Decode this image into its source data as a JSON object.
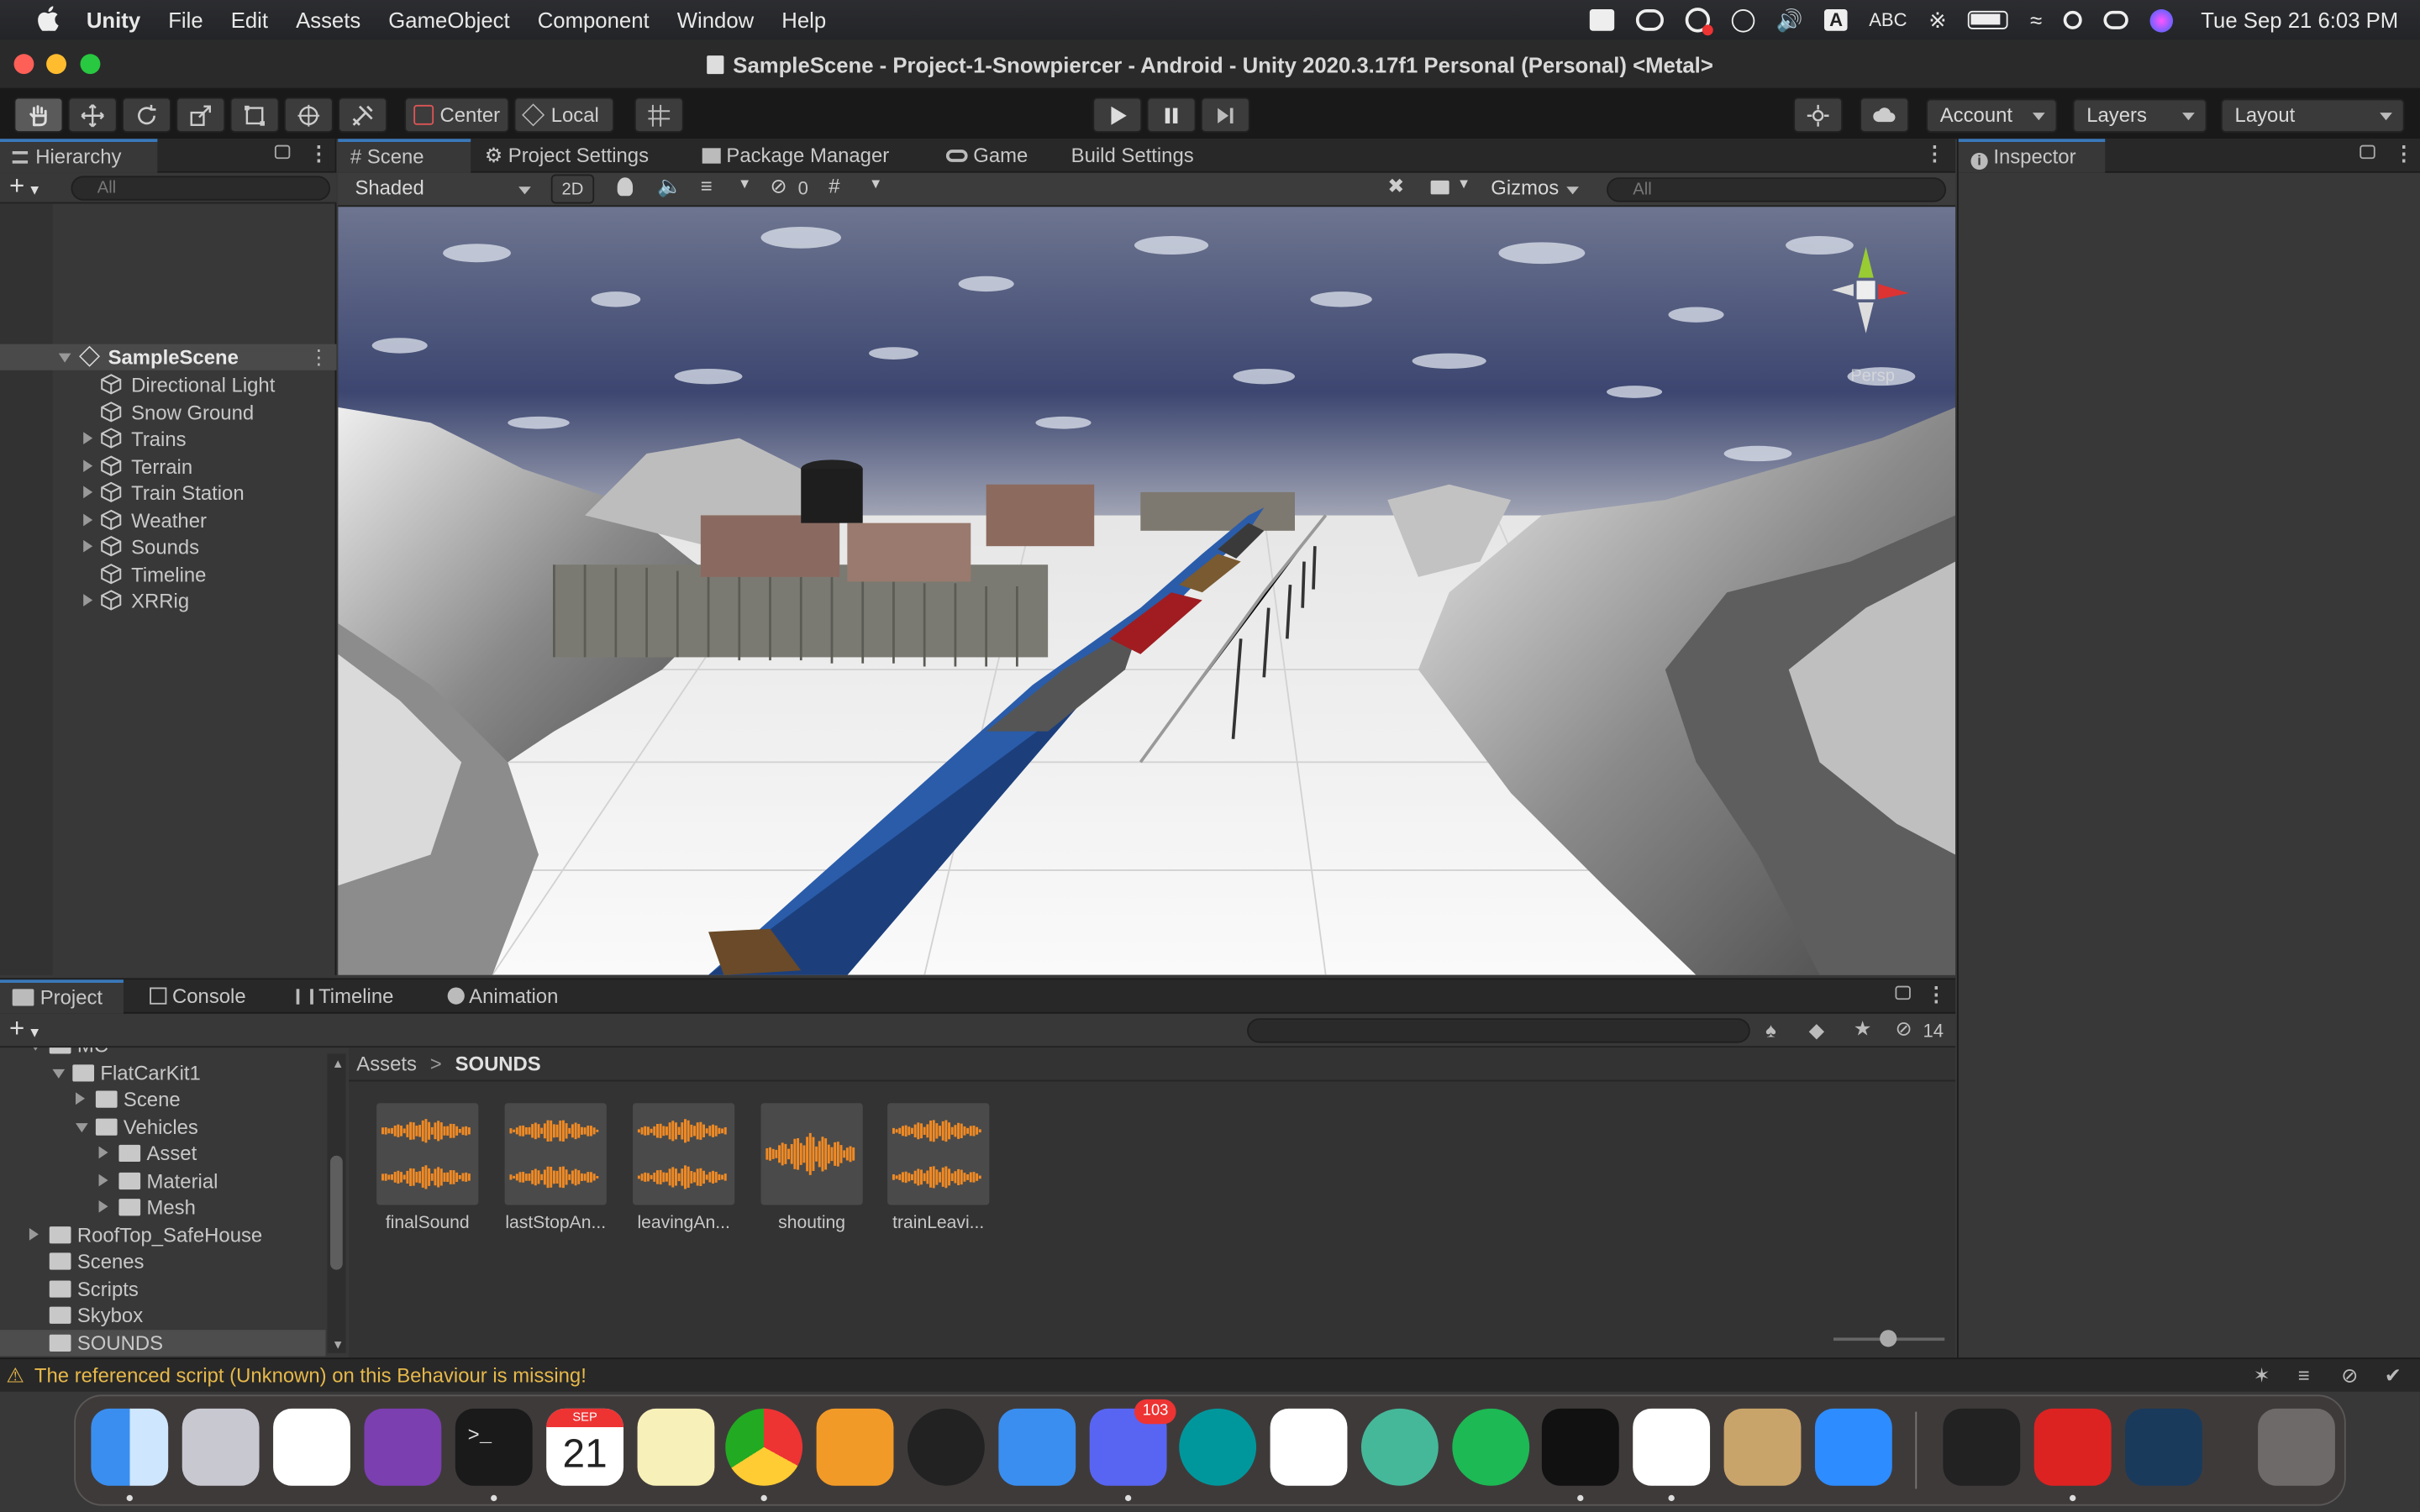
{
  "menubar": {
    "app": "Unity",
    "items": [
      "File",
      "Edit",
      "Assets",
      "GameObject",
      "Component",
      "Window",
      "Help"
    ],
    "input_source": "ABC",
    "datetime": "Tue Sep 21  6:03 PM"
  },
  "window": {
    "title": "SampleScene - Project-1-Snowpiercer - Android - Unity 2020.3.17f1 Personal (Personal) <Metal>"
  },
  "toolbar": {
    "pivot_label": "Center",
    "space_label": "Local",
    "account_label": "Account",
    "layers_label": "Layers",
    "layout_label": "Layout"
  },
  "hierarchy": {
    "tab_label": "Hierarchy",
    "search_placeholder": "All",
    "scene_name": "SampleScene",
    "items": [
      {
        "label": "Directional Light",
        "expandable": false
      },
      {
        "label": "Snow Ground",
        "expandable": false
      },
      {
        "label": "Trains",
        "expandable": true
      },
      {
        "label": "Terrain",
        "expandable": true
      },
      {
        "label": "Train Station",
        "expandable": true
      },
      {
        "label": "Weather",
        "expandable": true
      },
      {
        "label": "Sounds",
        "expandable": true
      },
      {
        "label": "Timeline",
        "expandable": false
      },
      {
        "label": "XRRig",
        "expandable": true
      }
    ]
  },
  "scene_tabs": [
    "Scene",
    "Project Settings",
    "Package Manager",
    "Game",
    "Build Settings"
  ],
  "scene_toolbar": {
    "draw_mode": "Shaded",
    "mode_2d": "2D",
    "hidden_count": "0",
    "gizmos_label": "Gizmos",
    "search_placeholder": "All"
  },
  "scene_view": {
    "gizmo_label": "Persp"
  },
  "inspector": {
    "tab_label": "Inspector"
  },
  "bottom_tabs": [
    "Project",
    "Console",
    "Timeline",
    "Animation"
  ],
  "project": {
    "hidden_count": "14",
    "breadcrumb": {
      "root": "Assets",
      "current": "SOUNDS"
    },
    "tree": [
      {
        "label": "MC",
        "indent": 2,
        "open": true,
        "arrow": true
      },
      {
        "label": "FlatCarKit1",
        "indent": 3,
        "open": true,
        "arrow": true
      },
      {
        "label": "Scene",
        "indent": 4,
        "open": false,
        "arrow": true
      },
      {
        "label": "Vehicles",
        "indent": 4,
        "open": true,
        "arrow": true
      },
      {
        "label": "Asset",
        "indent": 5,
        "open": false,
        "arrow": true
      },
      {
        "label": "Material",
        "indent": 5,
        "open": false,
        "arrow": true
      },
      {
        "label": "Mesh",
        "indent": 5,
        "open": false,
        "arrow": true
      },
      {
        "label": "RoofTop_SafeHouse",
        "indent": 2,
        "open": false,
        "arrow": true
      },
      {
        "label": "Scenes",
        "indent": 2,
        "open": false,
        "arrow": false
      },
      {
        "label": "Scripts",
        "indent": 2,
        "open": false,
        "arrow": false
      },
      {
        "label": "Skybox",
        "indent": 2,
        "open": false,
        "arrow": false
      },
      {
        "label": "SOUNDS",
        "indent": 2,
        "open": false,
        "arrow": false,
        "selected": true
      }
    ],
    "assets": [
      "finalSound",
      "lastStopAn...",
      "leavingAn...",
      "shouting",
      "trainLeavi..."
    ]
  },
  "status": {
    "message": "The referenced script (Unknown) on this Behaviour is missing!"
  },
  "dock": {
    "calendar_month": "SEP",
    "calendar_day": "21",
    "discord_badge": "103",
    "apps": [
      "finder-icon",
      "launchpad-icon",
      "slack-icon",
      "github-desktop-icon",
      "terminal-icon",
      "calendar-icon",
      "notes-icon",
      "chrome-icon",
      "sublime-text-icon",
      "p3-icon",
      "xcode-icon",
      "discord-icon",
      "arduino-icon",
      "visual-studio-icon",
      "atom-icon",
      "spotify-icon",
      "unity-hub-icon",
      "unity-icon",
      "archive-utility-icon",
      "zoom-icon",
      "unity-editor-icon",
      "photo-booth-icon",
      "quicktime-icon",
      "trash-icon"
    ]
  },
  "colors": {
    "accent": "#3a79bb",
    "warning": "#e6b84a",
    "panel": "#383838",
    "audio_waveform": "#f08a24"
  }
}
